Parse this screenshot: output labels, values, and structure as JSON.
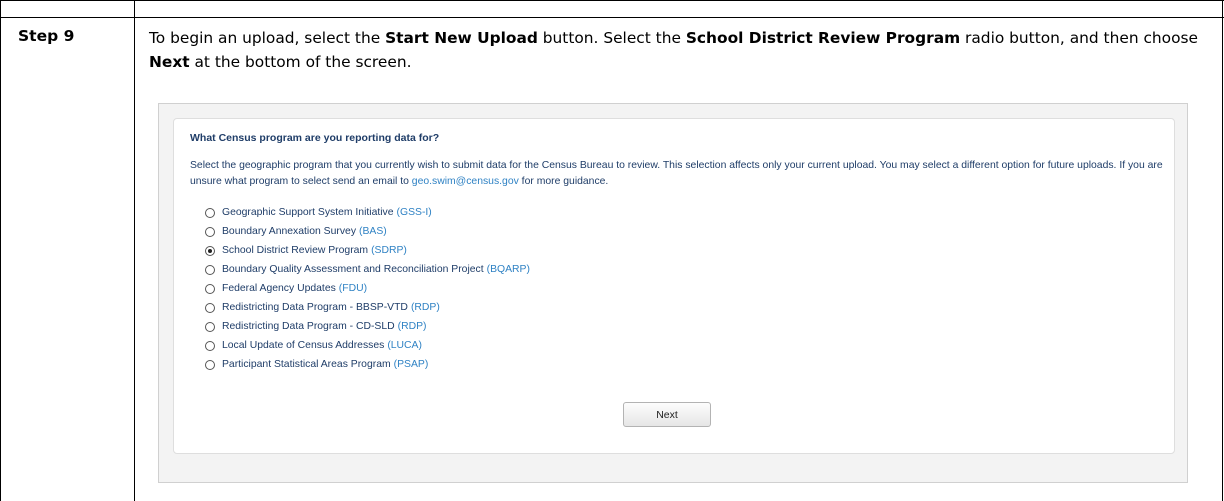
{
  "step": {
    "label": "Step 9"
  },
  "instructions": {
    "t1": "To begin an upload, select the ",
    "b1": "Start New Upload",
    "t2": " button. Select the ",
    "b2": "School District Review Program",
    "t3": " radio button, and then choose ",
    "b3": "Next",
    "t4": " at the bottom of the screen."
  },
  "screen": {
    "question": "What Census program are you reporting data for?",
    "description": "Select the geographic program that you currently wish to submit data for the Census Bureau to review. This selection affects only your current upload. You may select a different option for future uploads. If you are unsure what program to select send an email to ",
    "email": "geo.swim@census.gov",
    "description_end": " for more guidance.",
    "options": [
      {
        "label": "Geographic Support System Initiative",
        "abbr": "(GSS-I)",
        "selected": false
      },
      {
        "label": "Boundary Annexation Survey",
        "abbr": "(BAS)",
        "selected": false
      },
      {
        "label": "School District Review Program",
        "abbr": "(SDRP)",
        "selected": true
      },
      {
        "label": "Boundary Quality Assessment and Reconciliation Project",
        "abbr": "(BQARP)",
        "selected": false
      },
      {
        "label": "Federal Agency Updates",
        "abbr": "(FDU)",
        "selected": false
      },
      {
        "label": "Redistricting Data Program - BBSP-VTD",
        "abbr": "(RDP)",
        "selected": false
      },
      {
        "label": "Redistricting Data Program - CD-SLD",
        "abbr": "(RDP)",
        "selected": false
      },
      {
        "label": "Local Update of Census Addresses",
        "abbr": "(LUCA)",
        "selected": false
      },
      {
        "label": "Participant Statistical Areas Program",
        "abbr": "(PSAP)",
        "selected": false
      }
    ],
    "next_label": "Next"
  }
}
